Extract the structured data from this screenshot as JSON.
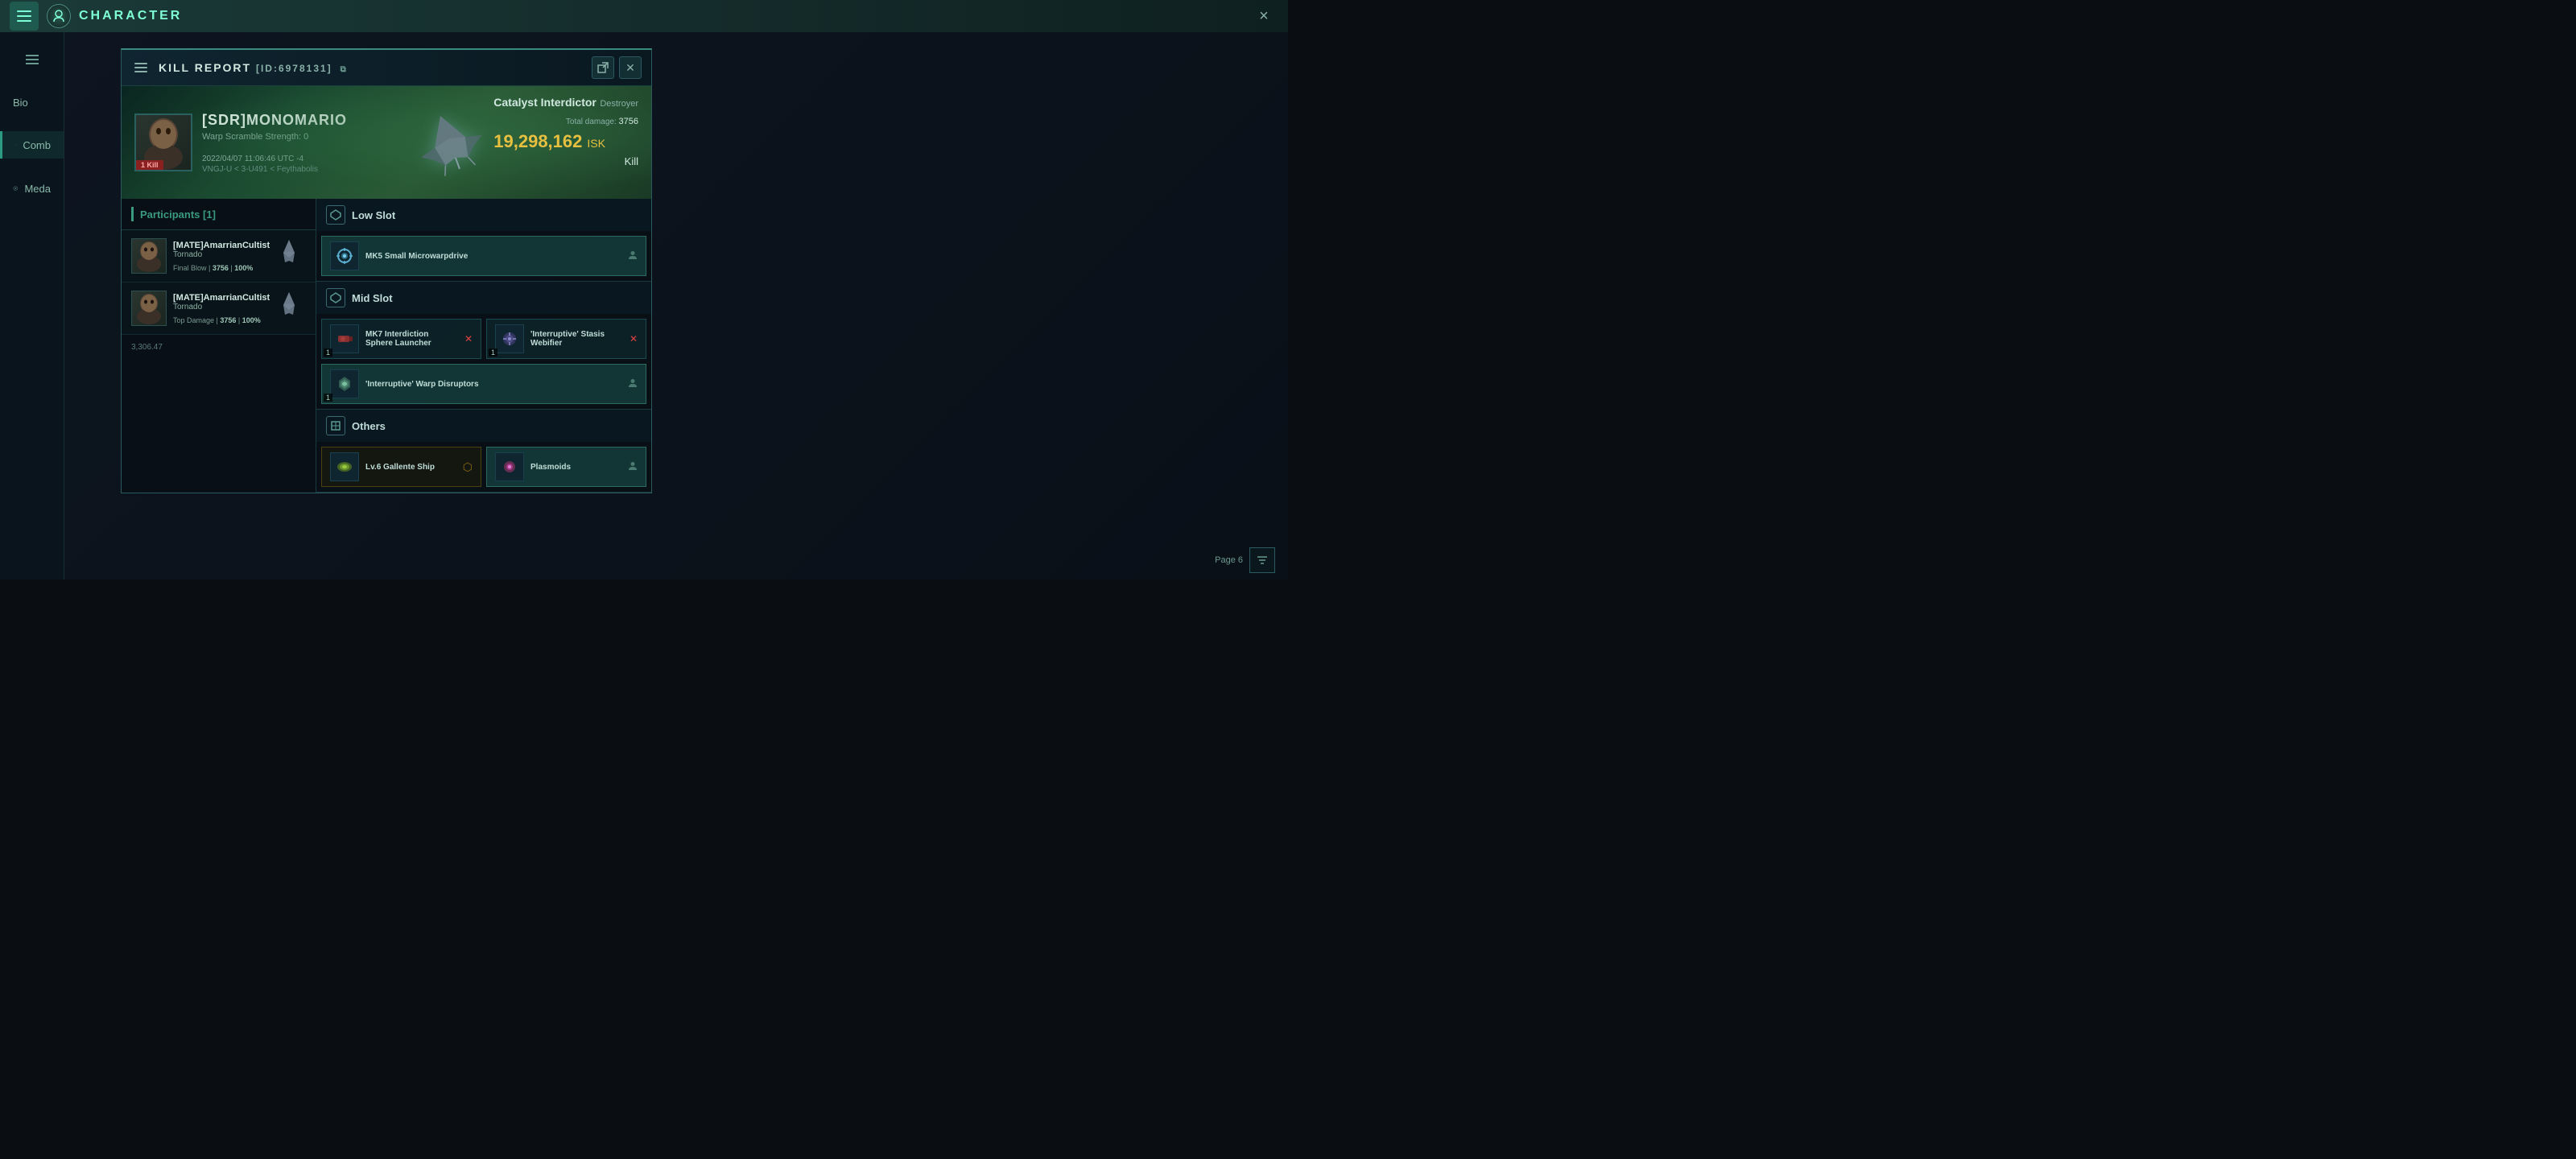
{
  "topbar": {
    "title": "CHARACTER",
    "close_label": "×"
  },
  "kill_report": {
    "title": "KILL REPORT",
    "id": "[ID:6978131]",
    "victim": {
      "name": "[SDR]MONOMARIO",
      "warp_scramble": "Warp Scramble Strength: 0",
      "kill_badge": "1 Kill",
      "ship_name": "Catalyst Interdictor",
      "ship_class": "Destroyer",
      "total_damage_label": "Total damage:",
      "total_damage_value": "3756",
      "isk_value": "19,298,162",
      "isk_label": "ISK",
      "result": "Kill",
      "datetime": "2022/04/07 11:06:46 UTC -4",
      "location": "VNGJ-U < 3-U491 < Feythabolis"
    },
    "participants_title": "Participants [1]",
    "participants": [
      {
        "name": "[MATE]AmarrianCultist",
        "ship": "Tornado",
        "role": "Final Blow",
        "damage": "3756",
        "percent": "100%"
      },
      {
        "name": "[MATE]AmarrianCultist",
        "ship": "Tornado",
        "role": "Top Damage",
        "damage": "3756",
        "percent": "100%"
      }
    ],
    "slots": {
      "low_slot": {
        "title": "Low Slot",
        "items": [
          {
            "name": "MK5 Small Microwarpdrive",
            "count": null,
            "has_person": true,
            "has_close": false,
            "highlighted": true
          }
        ]
      },
      "mid_slot": {
        "title": "Mid Slot",
        "items": [
          {
            "name": "MK7 Interdiction Sphere Launcher",
            "count": "1",
            "has_person": false,
            "has_close": true,
            "highlighted": false
          },
          {
            "name": "'Interruptive' Stasis Webifier",
            "count": "1",
            "has_person": false,
            "has_close": true,
            "highlighted": false
          },
          {
            "name": "'Interruptive' Warp Disruptors",
            "count": "1",
            "has_person": true,
            "has_close": false,
            "highlighted": true
          }
        ]
      },
      "others": {
        "title": "Others",
        "items": [
          {
            "name": "Lv.6 Gallente Ship",
            "count": null,
            "has_person": false,
            "has_close": false,
            "highlighted": false,
            "is_skill": true
          },
          {
            "name": "Plasmoids",
            "count": null,
            "has_person": true,
            "has_close": false,
            "highlighted": true,
            "is_skill": false
          }
        ]
      }
    },
    "bottom": {
      "page_text": "Page 6",
      "bottom_value": "3,306.47"
    }
  }
}
